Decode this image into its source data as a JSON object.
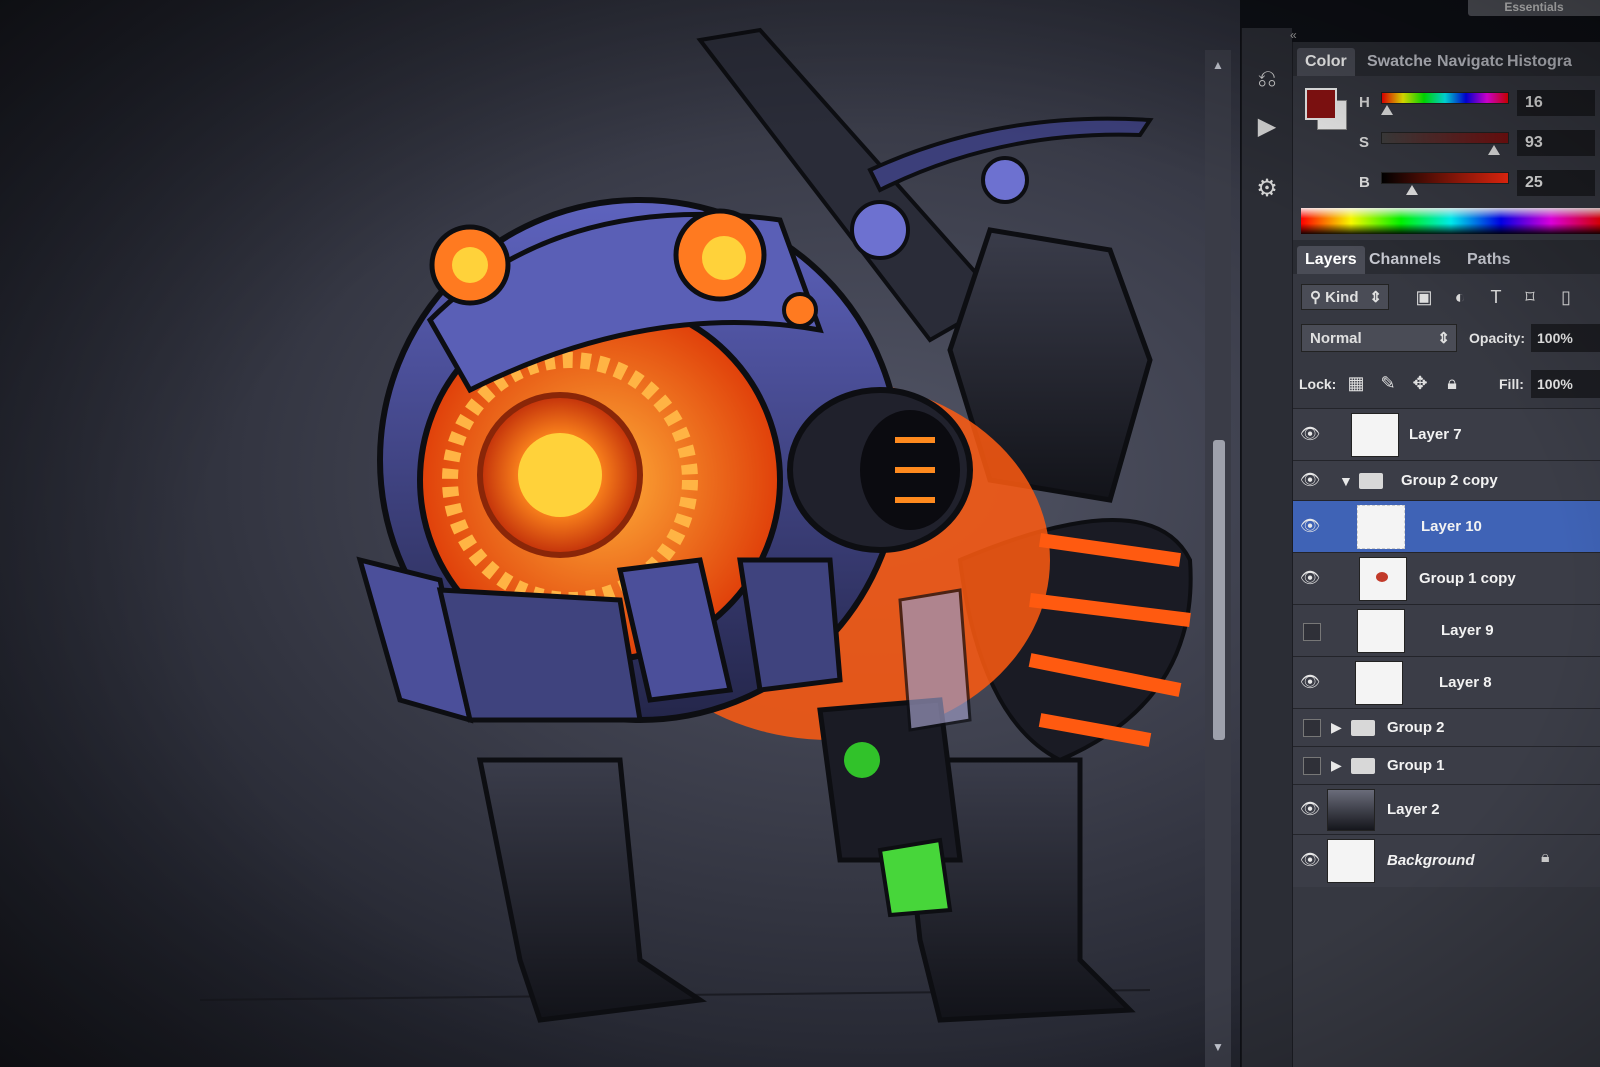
{
  "top_bar": {
    "workspace_label": "Essentials"
  },
  "dock": {
    "icons": [
      "history-icon",
      "play-action-icon",
      "properties-icon"
    ]
  },
  "color_panel": {
    "tabs": [
      "Color",
      "Swatche",
      "Navigatc",
      "Histogra"
    ],
    "active_tab": "Color",
    "foreground_color": "#7a1010",
    "background_color": "#f2f2f2",
    "sliders": [
      {
        "label": "H",
        "value": "16"
      },
      {
        "label": "S",
        "value": "93"
      },
      {
        "label": "B",
        "value": "25"
      }
    ],
    "slider_levels": [
      0.04,
      0.93,
      0.25
    ]
  },
  "layers_panel": {
    "tabs": [
      "Layers",
      "Channels",
      "Paths"
    ],
    "active_tab": "Layers",
    "filter_kind": "Kind",
    "blend_mode": "Normal",
    "opacity_label": "Opacity:",
    "opacity_value": "100%",
    "lock_label": "Lock:",
    "fill_label": "Fill:",
    "fill_value": "100%",
    "layers": [
      {
        "name": "Layer 7",
        "visible": true,
        "type": "layer"
      },
      {
        "name": "Group 2 copy",
        "visible": true,
        "type": "group-open"
      },
      {
        "name": "Layer 10",
        "visible": true,
        "type": "layer",
        "selected": true
      },
      {
        "name": "Group 1 copy",
        "visible": true,
        "type": "layer"
      },
      {
        "name": "Layer 9",
        "visible": false,
        "type": "layer"
      },
      {
        "name": "Layer 8",
        "visible": true,
        "type": "layer"
      },
      {
        "name": "Group 2",
        "visible": false,
        "type": "group-closed"
      },
      {
        "name": "Group 1",
        "visible": false,
        "type": "group-closed"
      },
      {
        "name": "Layer 2",
        "visible": true,
        "type": "layer"
      },
      {
        "name": "Background",
        "visible": true,
        "type": "background"
      }
    ]
  },
  "colors": {
    "accent_orange": "#ff5a10",
    "glow_yellow": "#ffd23a",
    "armor_purple": "#4a4ea8",
    "selection_blue": "#3f63b6"
  }
}
